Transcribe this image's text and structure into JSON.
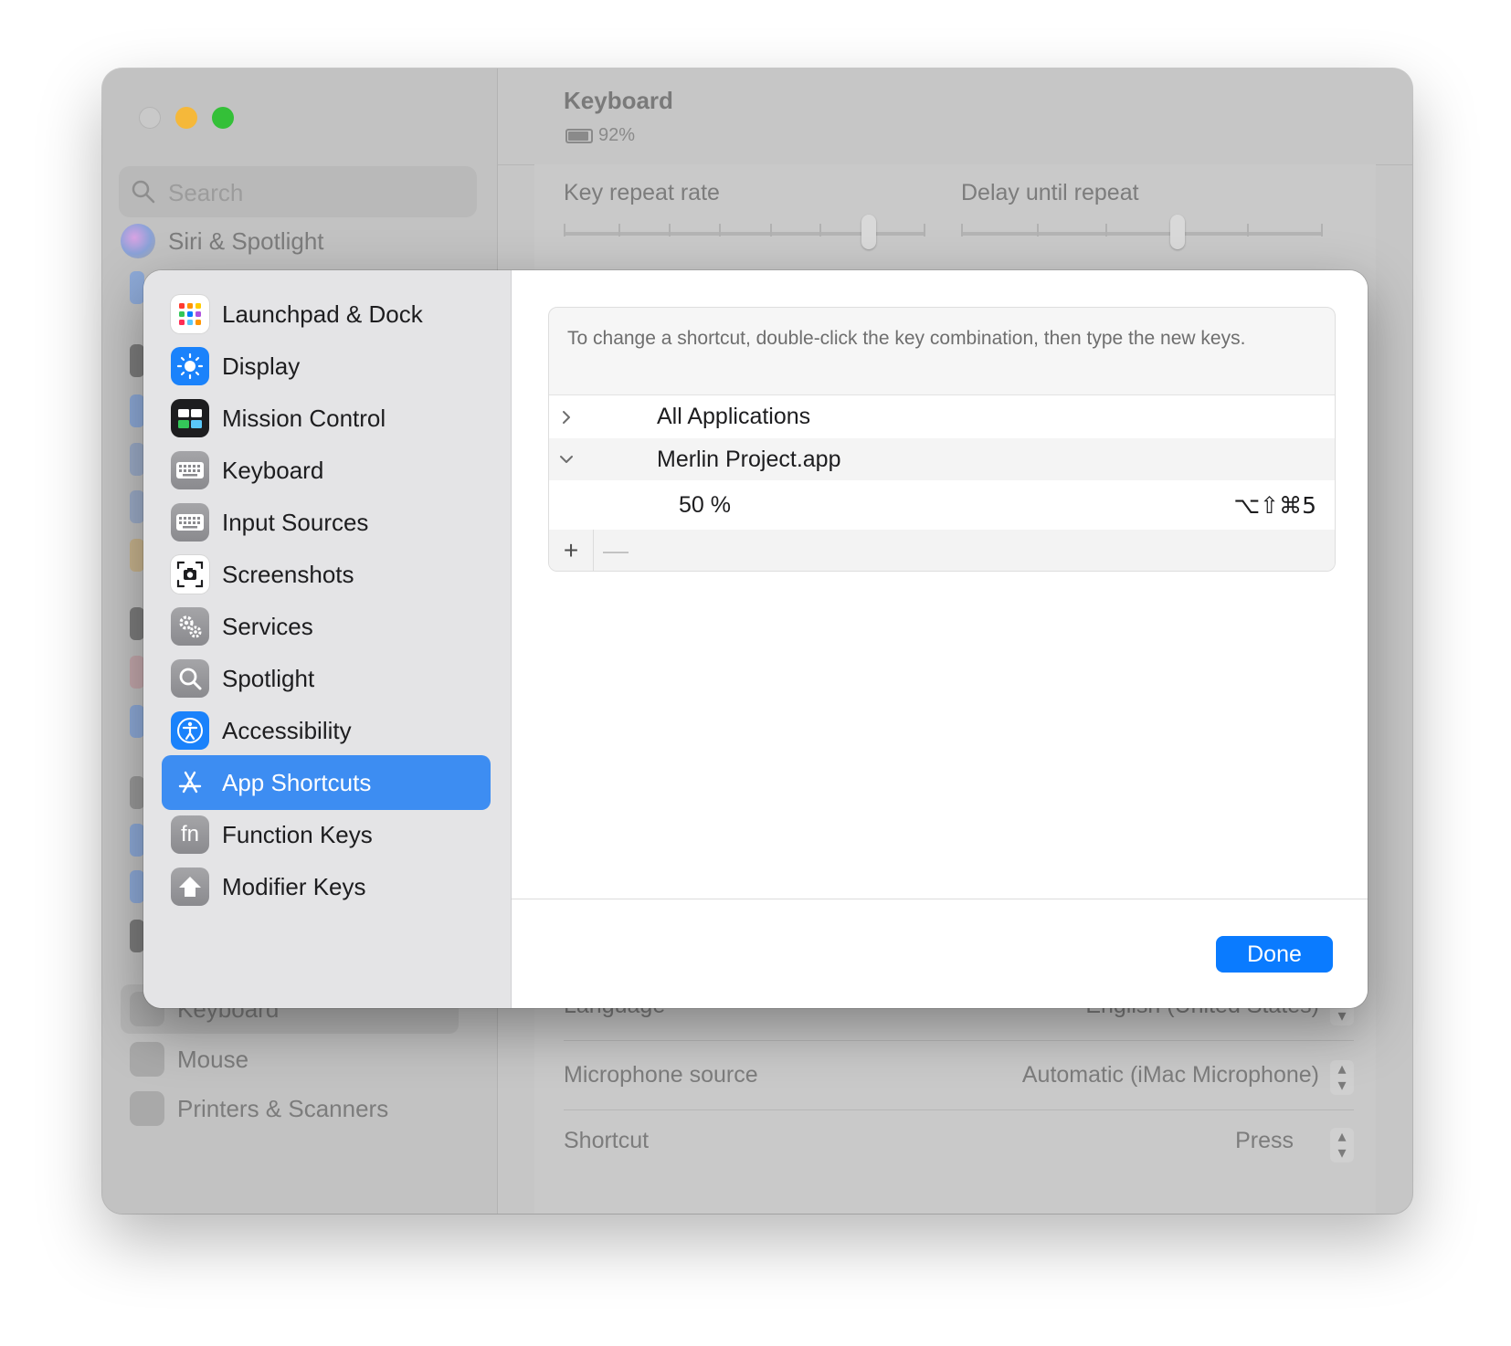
{
  "window": {
    "search": {
      "placeholder": "Search"
    },
    "sidebar": {
      "items": [
        {
          "label": "Siri & Spotlight",
          "icon": "siri-icon"
        },
        {
          "label": "Keyboard",
          "icon": "keyboard-icon",
          "selected": true
        },
        {
          "label": "Mouse",
          "icon": "mouse-icon"
        },
        {
          "label": "Printers & Scanners",
          "icon": "printer-icon"
        }
      ]
    },
    "main": {
      "title": "Keyboard",
      "battery": "92%",
      "key_repeat_rate_label": "Key repeat rate",
      "delay_until_repeat_label": "Delay until repeat",
      "dictation": [
        {
          "label": "Language",
          "value": "English (United States)"
        },
        {
          "label": "Microphone source",
          "value": "Automatic (iMac Microphone)"
        },
        {
          "label": "Shortcut",
          "value": "Press"
        }
      ]
    }
  },
  "sheet": {
    "sidebar": {
      "items": [
        {
          "label": "Launchpad & Dock",
          "icon": "launchpad-icon"
        },
        {
          "label": "Display",
          "icon": "display-icon"
        },
        {
          "label": "Mission Control",
          "icon": "mission-control-icon"
        },
        {
          "label": "Keyboard",
          "icon": "keyboard-icon"
        },
        {
          "label": "Input Sources",
          "icon": "input-sources-icon"
        },
        {
          "label": "Screenshots",
          "icon": "screenshot-icon"
        },
        {
          "label": "Services",
          "icon": "gear-icon"
        },
        {
          "label": "Spotlight",
          "icon": "spotlight-icon"
        },
        {
          "label": "Accessibility",
          "icon": "accessibility-icon"
        },
        {
          "label": "App Shortcuts",
          "icon": "app-store-icon",
          "selected": true
        },
        {
          "label": "Function Keys",
          "icon": "fn-icon"
        },
        {
          "label": "Modifier Keys",
          "icon": "modifier-key-icon"
        }
      ]
    },
    "hint": "To change a shortcut, double-click the key combination, then type the new keys.",
    "groups": [
      {
        "name": "All Applications",
        "expanded": false
      },
      {
        "name": "Merlin Project.app",
        "expanded": true
      }
    ],
    "shortcut": {
      "name": "50 %",
      "keys": "⌥⇧⌘5"
    },
    "add_label": "+",
    "remove_label": "—",
    "done_label": "Done",
    "colors": {
      "accent": "#0a7bff",
      "selection": "#3d8df2"
    }
  }
}
